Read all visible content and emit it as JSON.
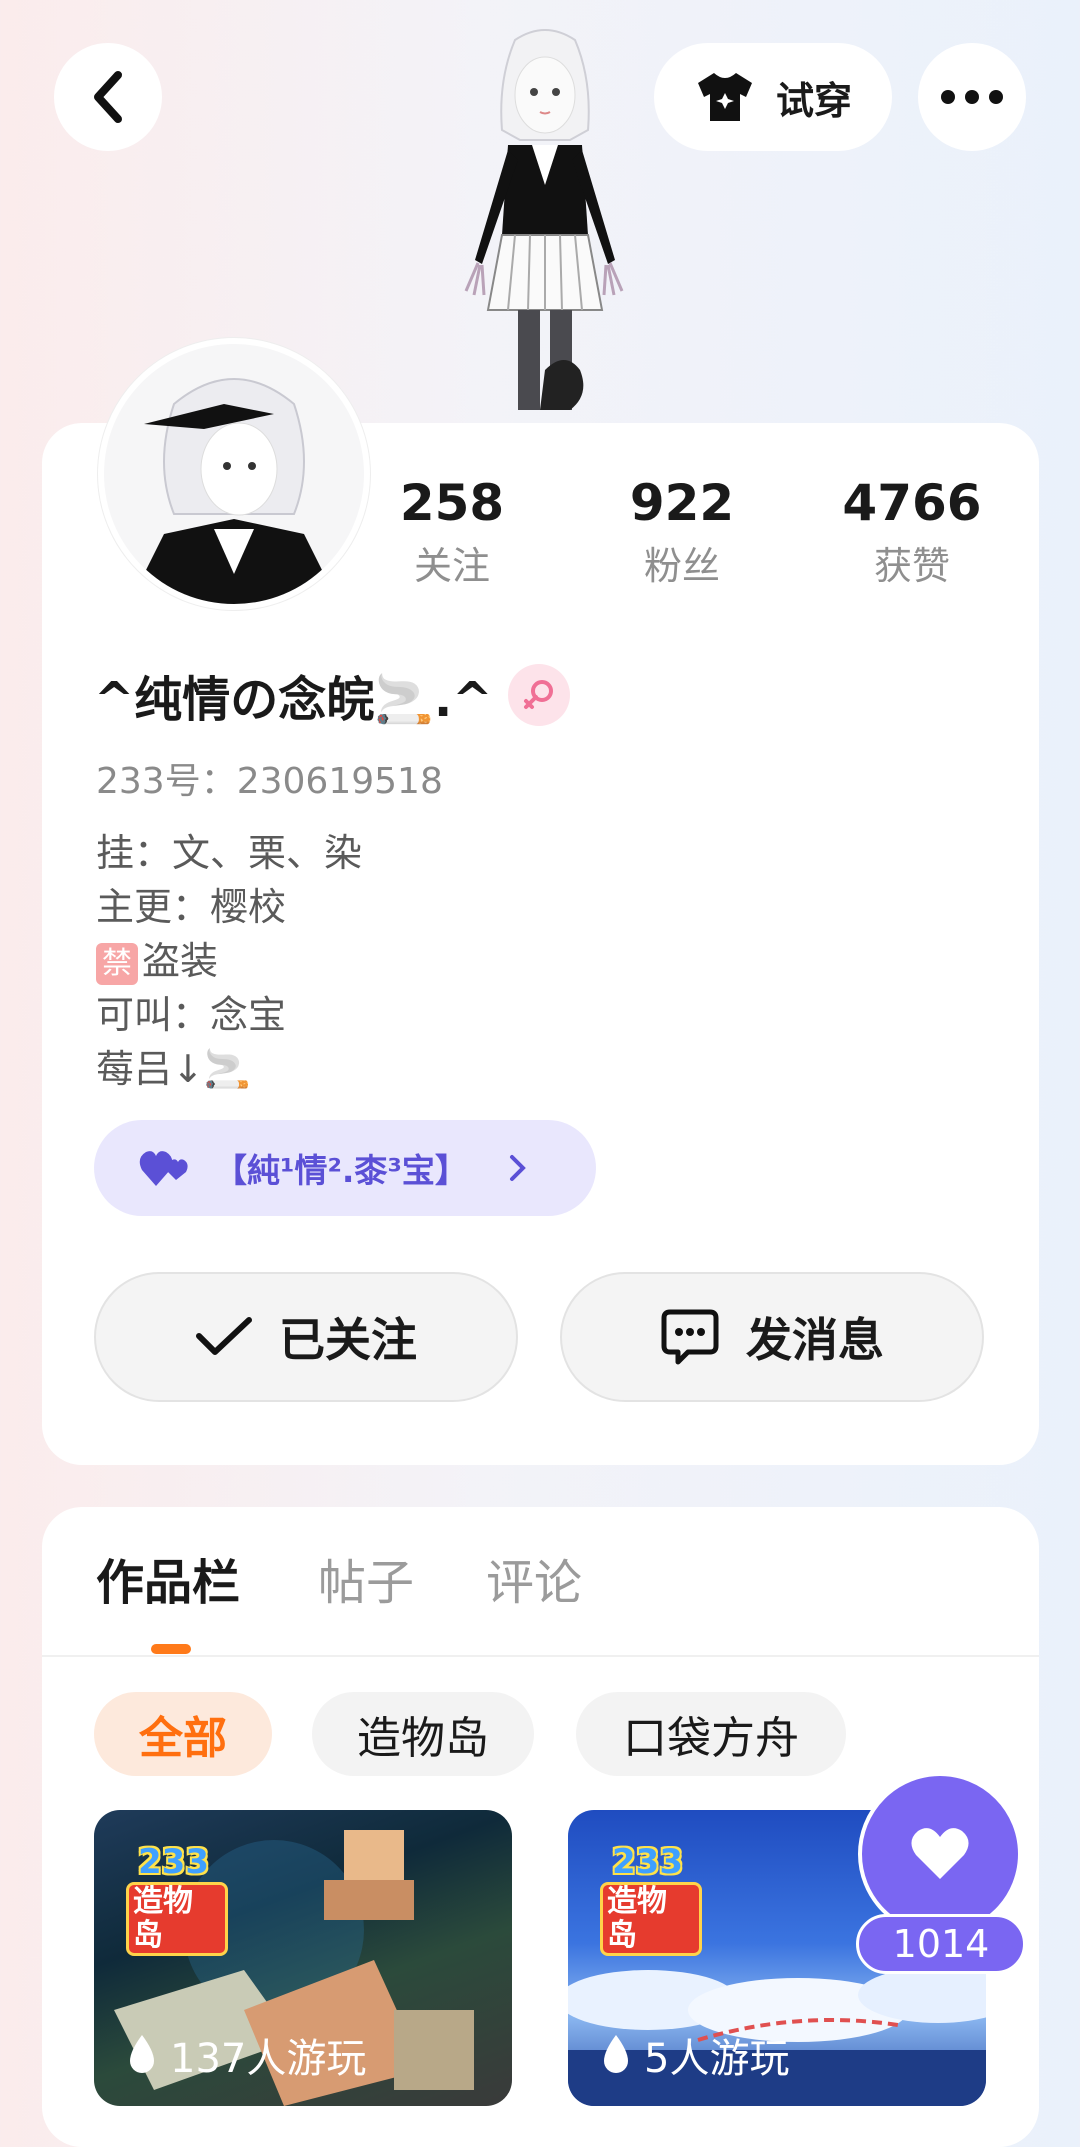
{
  "header": {
    "back_icon": "chevron-left-icon",
    "try_on_label": "试穿",
    "more_icon": "more-dots-icon"
  },
  "profile": {
    "stats": [
      {
        "value": "258",
        "label": "关注"
      },
      {
        "value": "922",
        "label": "粉丝"
      },
      {
        "value": "4766",
        "label": "获赞"
      }
    ],
    "nickname": "^纯情の念皖🚬.^",
    "gender": "female",
    "uid": "233号：230619518",
    "bio_lines": [
      "挂：文、栗、染",
      "主更：樱校",
      "盗装",
      "可叫：念宝",
      "莓吕↓🚬"
    ],
    "bio_forbid_badge": "禁",
    "friend_tag": "【純¹情².桼³宝】",
    "follow_button": "已关注",
    "message_button": "发消息"
  },
  "tabs": [
    {
      "label": "作品栏",
      "active": true
    },
    {
      "label": "帖子",
      "active": false
    },
    {
      "label": "评论",
      "active": false
    }
  ],
  "filters": [
    {
      "label": "全部",
      "selected": true
    },
    {
      "label": "造物岛",
      "selected": false
    },
    {
      "label": "口袋方舟",
      "selected": false
    }
  ],
  "games": [
    {
      "logo_top": "233",
      "logo_bottom": "造物岛",
      "plays": "137人游玩"
    },
    {
      "logo_top": "233",
      "logo_bottom": "造物岛",
      "plays": "5人游玩"
    }
  ],
  "like": {
    "count": "1014"
  },
  "colors": {
    "accent_orange": "#ff7a1a",
    "accent_purple": "#7a66f2"
  }
}
